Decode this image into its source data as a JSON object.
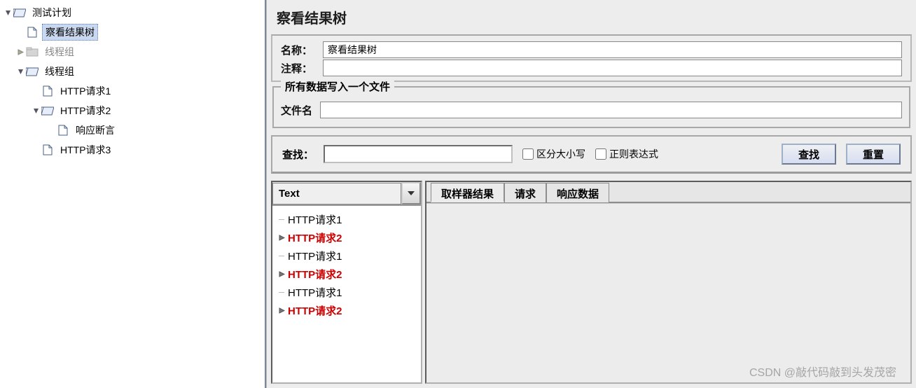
{
  "tree": {
    "root": "测试计划",
    "selected": "察看结果树",
    "threadGroupDisabled": "线程组",
    "threadGroup": "线程组",
    "http1": "HTTP请求1",
    "http2": "HTTP请求2",
    "assertion": "响应断言",
    "http3": "HTTP请求3"
  },
  "panel": {
    "title": "察看结果树",
    "nameLabel": "名称：",
    "nameValue": "察看结果树",
    "commentLabel": "注释：",
    "commentValue": "",
    "writeFieldset": "所有数据写入一个文件",
    "filenameLabel": "文件名",
    "filenameValue": ""
  },
  "search": {
    "label": "查找：",
    "caseSensitive": "区分大小写",
    "regex": "正则表达式",
    "findBtn": "查找",
    "resetBtn": "重置"
  },
  "results": {
    "dropdown": "Text",
    "items": [
      {
        "label": "HTTP请求1",
        "fail": false,
        "expandable": false
      },
      {
        "label": "HTTP请求2",
        "fail": true,
        "expandable": true
      },
      {
        "label": "HTTP请求1",
        "fail": false,
        "expandable": false
      },
      {
        "label": "HTTP请求2",
        "fail": true,
        "expandable": true
      },
      {
        "label": "HTTP请求1",
        "fail": false,
        "expandable": false
      },
      {
        "label": "HTTP请求2",
        "fail": true,
        "expandable": true
      }
    ]
  },
  "tabs": {
    "sampler": "取样器结果",
    "request": "请求",
    "response": "响应数据"
  },
  "watermark": "CSDN @敲代码敲到头发茂密"
}
